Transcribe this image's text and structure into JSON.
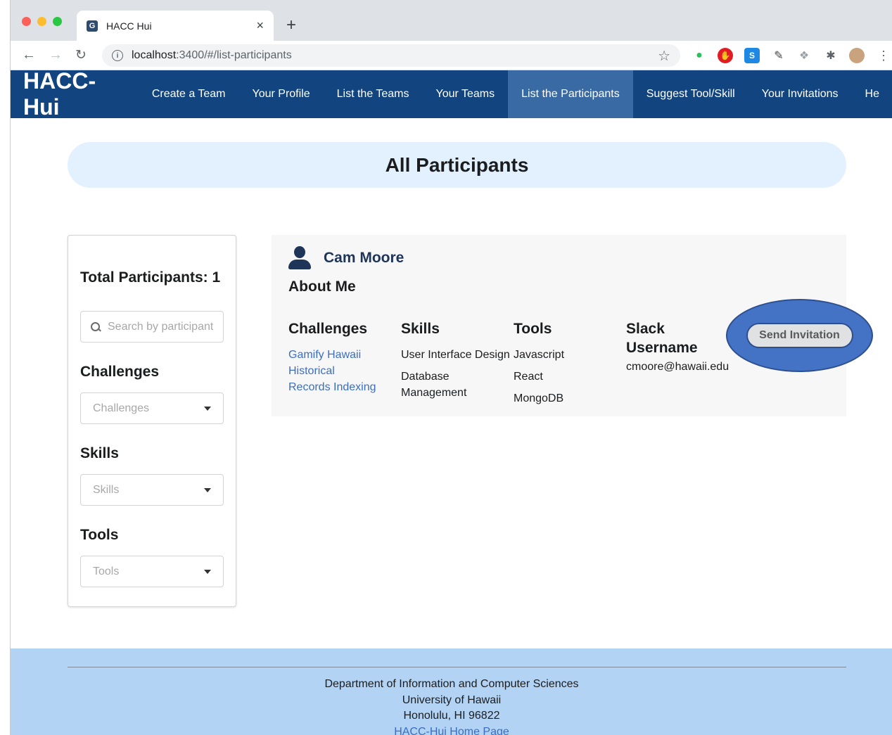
{
  "browser": {
    "tab_title": "HACC Hui",
    "favicon_letter": "G",
    "url_host": "localhost",
    "url_path": ":3400/#/list-participants",
    "new_tab": "+",
    "close_tab": "×"
  },
  "navbar": {
    "brand": "HACC-Hui",
    "items": [
      "Create a Team",
      "Your Profile",
      "List the Teams",
      "Your Teams",
      "List the Participants",
      "Suggest Tool/Skill",
      "Your Invitations",
      "He"
    ],
    "active_item": "List the Participants",
    "bg_color": "#124580",
    "active_color": "#3a6aa3"
  },
  "page": {
    "heading": "All Participants"
  },
  "sidebar": {
    "total": "Total Participants: 1",
    "search_placeholder": "Search by participant",
    "challenges_label": "Challenges",
    "challenges_placeholder": "Challenges",
    "skills_label": "Skills",
    "skills_placeholder": "Skills",
    "tools_label": "Tools",
    "tools_placeholder": "Tools"
  },
  "participant": {
    "name": "Cam Moore",
    "about_label": "About Me",
    "challenges_title": "Challenges",
    "challenges": [
      "Gamify Hawaii",
      "Historical",
      "Records Indexing"
    ],
    "skills_title": "Skills",
    "skills": [
      "User Interface Design",
      "Database Management"
    ],
    "tools_title": "Tools",
    "tools": [
      "Javascript",
      "React",
      "MongoDB"
    ],
    "slack_title": "Slack Username",
    "slack_username": "cmoore@hawaii.edu",
    "invite_label": "Send Invitation"
  },
  "footer": {
    "line1": "Department of Information and Computer Sciences",
    "line2": "University of Hawaii",
    "line3": "Honolulu, HI 96822",
    "link": "HACC-Hui Home Page"
  },
  "colors": {
    "heading_bg": "#e3f1ff",
    "footer_bg": "#b3d3f5",
    "link": "#3b6ec2",
    "highlight_oval": "#4472c4"
  }
}
